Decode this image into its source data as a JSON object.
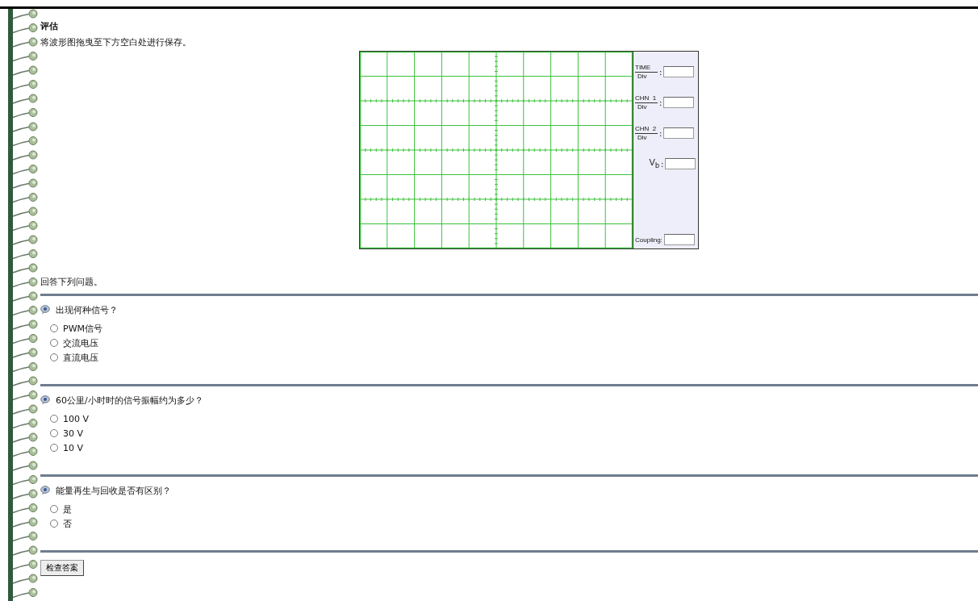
{
  "section": {
    "title": "评估",
    "instruction": "将波形图拖曳至下方空白处进行保存。"
  },
  "scope": {
    "controls": [
      {
        "kind": "fraction",
        "top": "TIME",
        "bottom": "Div",
        "sep": ":"
      },
      {
        "kind": "fraction",
        "top": "CHN  1",
        "bottom": "Div",
        "sep": ":"
      },
      {
        "kind": "fraction",
        "top": "CHN  2",
        "bottom": "Div",
        "sep": ":"
      },
      {
        "kind": "plain",
        "label": "V$_{b}$",
        "sep": ":"
      }
    ],
    "coupling": "Coupling:"
  },
  "prompt": "回答下列问题。",
  "questions": [
    {
      "text": "出现何种信号？",
      "options": [
        {
          "label": "PWM信号",
          "selected": false
        },
        {
          "label": "交流电压",
          "selected": false
        },
        {
          "label": "直流电压",
          "selected": false
        }
      ]
    },
    {
      "text": "60公里/小时时的信号振幅约为多少？",
      "options": [
        {
          "label": "100 V",
          "selected": false
        },
        {
          "label": "30 V",
          "selected": false
        },
        {
          "label": "10 V",
          "selected": false
        }
      ]
    },
    {
      "text": "能量再生与回收是否有区别？",
      "options": [
        {
          "label": "是",
          "selected": false
        },
        {
          "label": "否",
          "selected": false
        }
      ]
    }
  ],
  "check_button": "检查答案"
}
